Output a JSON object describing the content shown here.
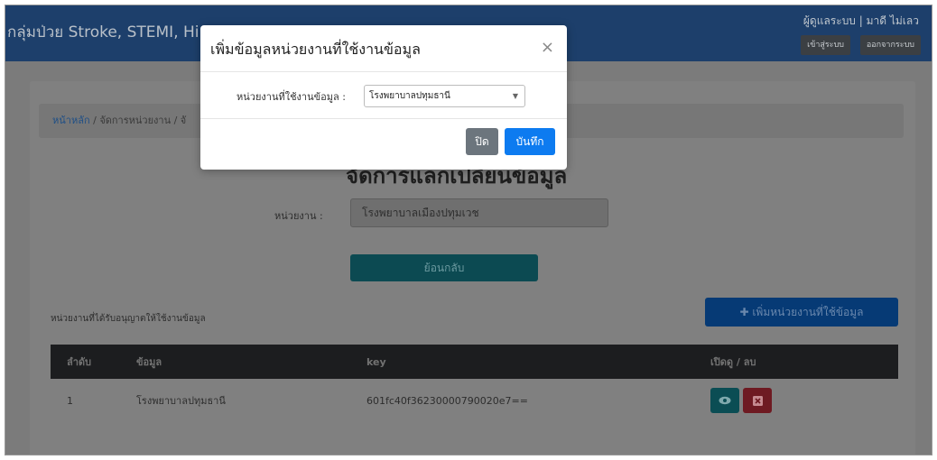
{
  "header": {
    "brand": "กลุ่มป่วย Stroke, STEMI, Hi",
    "user_info": "ผู้ดูแลระบบ | มาดี ไม่เลว",
    "login_label": "เข้าสู่ระบบ",
    "logout_label": "ออกจากระบบ"
  },
  "breadcrumb": {
    "home": "หน้าหลัก",
    "sep": " / ",
    "current": "จัดการหน่วยงาน / จั"
  },
  "page": {
    "heading": "จัดการแลกเปลี่ยนข้อมูล",
    "unit_label": "หน่วยงาน :",
    "unit_value": "โรงพยาบาลเมืองปทุมเวช",
    "back_label": "ย้อนกลับ",
    "allowed_label": "หน่วยงานที่ได้รับอนุญาตให้ใช้งานข้อมูล",
    "add_label": "เพิ่มหน่วยงานที่ใช้ข้อมูล"
  },
  "table": {
    "headers": [
      "ลำดับ",
      "ข้อมูล",
      "key",
      "เปิดดู / ลบ"
    ],
    "rows": [
      {
        "no": "1",
        "name": "โรงพยาบาลปทุมธานี",
        "key": "601fc40f36230000790020e7=="
      }
    ]
  },
  "modal": {
    "title": "เพิ่มข้อมูลหน่วยงานที่ใช้งานข้อมูล",
    "close_symbol": "×",
    "field_label": "หน่วยงานที่ใช้งานข้อมูล :",
    "selected": "โรงพยาบาลปทุมธานี",
    "btn_close": "ปิด",
    "btn_save": "บันทึก"
  }
}
